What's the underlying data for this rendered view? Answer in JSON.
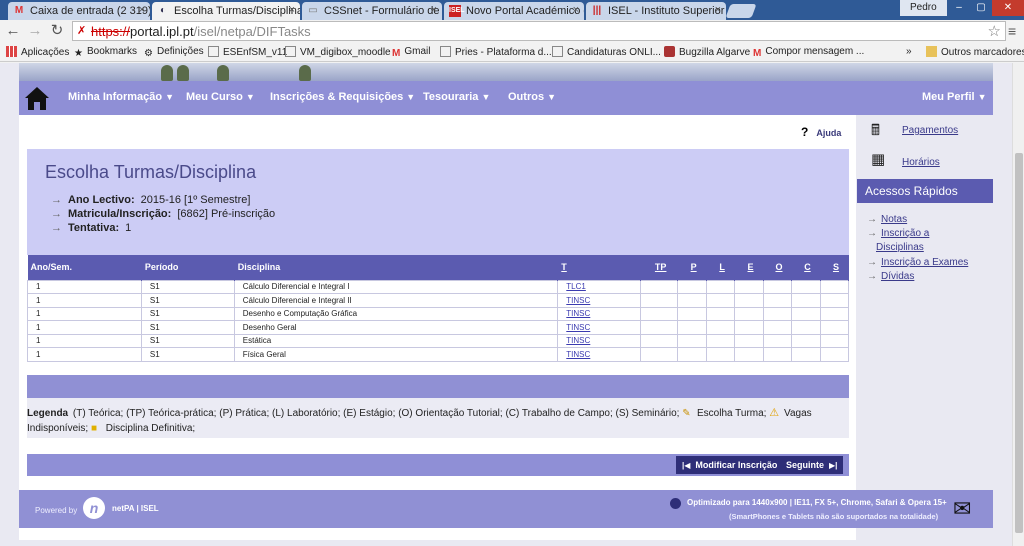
{
  "browser": {
    "tabs": [
      {
        "label": "Caixa de entrada (2 319) -",
        "icon": "gmail-icon",
        "active": false
      },
      {
        "label": "Escolha Turmas/Disciplina",
        "icon": "netpa-icon",
        "active": true
      },
      {
        "label": "CSSnet - Formulário de C",
        "icon": "doc-icon",
        "active": false
      },
      {
        "label": "Novo Portal Académico d",
        "icon": "isel-icon",
        "active": false
      },
      {
        "label": "ISEL - Instituto Superior d",
        "icon": "isel-bars-icon",
        "active": false
      }
    ],
    "user": "Pedro",
    "url_scheme": "https://",
    "url_host": "portal.ipl.pt",
    "url_path": "/isel/netpa/DIFTasks",
    "bookmarks": [
      "Aplicações",
      "Bookmarks",
      "Definições",
      "ESEnfSM_v11",
      "VM_digibox_moodle",
      "Gmail",
      "Pries - Plataforma d...",
      "Candidaturas ONLI...",
      "Bugzilla Algarve",
      "Compor mensagem ...",
      "»",
      "Outros marcadores"
    ]
  },
  "nav": {
    "items": [
      "Minha Informação",
      "Meu Curso",
      "Inscrições & Requisições",
      "Tesouraria",
      "Outros"
    ],
    "profile": "Meu Perfil"
  },
  "help": "Ajuda",
  "header": {
    "title": "Escolha Turmas/Disciplina",
    "ano_label": "Ano Lectivo:",
    "ano_value": "2015-16 [1º Semestre]",
    "matricula_label": "Matricula/Inscrição:",
    "matricula_value": "[6862] Pré-inscrição",
    "tentativa_label": "Tentativa:",
    "tentativa_value": "1"
  },
  "table": {
    "columns": [
      "Ano/Sem.",
      "Período",
      "Disciplina",
      "T",
      "TP",
      "P",
      "L",
      "E",
      "O",
      "C",
      "S"
    ],
    "rows": [
      {
        "ano": "1",
        "periodo": "S1",
        "disciplina": "Cálculo Diferencial e Integral I",
        "t": "TLC1"
      },
      {
        "ano": "1",
        "periodo": "S1",
        "disciplina": "Cálculo Diferencial e Integral II",
        "t": "TINSC"
      },
      {
        "ano": "1",
        "periodo": "S1",
        "disciplina": "Desenho e Computação Gráfica",
        "t": "TINSC"
      },
      {
        "ano": "1",
        "periodo": "S1",
        "disciplina": "Desenho Geral",
        "t": "TINSC"
      },
      {
        "ano": "1",
        "periodo": "S1",
        "disciplina": "Estática",
        "t": "TINSC"
      },
      {
        "ano": "1",
        "periodo": "S1",
        "disciplina": "Física Geral",
        "t": "TINSC"
      }
    ]
  },
  "legend": {
    "label": "Legenda",
    "text": "(T) Teórica; (TP) Teórica-prática; (P) Prática; (L) Laboratório; (E) Estágio; (O) Orientação Tutorial; (C) Trabalho de Campo; (S) Seminário;",
    "escolha": "Escolha Turma;",
    "vagas": "Vagas Indisponíveis;",
    "definitiva": "Disciplina Definitiva;"
  },
  "actions": {
    "modificar": "Modificar Inscrição",
    "seguinte": "Seguinte"
  },
  "sidebar": {
    "pagamentos": "Pagamentos",
    "horarios": "Horários",
    "quick_title": "Acessos Rápidos",
    "quick": [
      "Notas",
      "Inscrição a",
      "Disciplinas",
      "Inscrição a Exames",
      "Dívidas"
    ]
  },
  "footer": {
    "powered": "Powered by",
    "brand": "netPA | ISEL",
    "opt1": "Optimizado para 1440x900 | IE11, FX 5+, Chrome, Safari & Opera 15+",
    "opt2": "(SmartPhones e Tablets não são suportados na totalidade)"
  }
}
